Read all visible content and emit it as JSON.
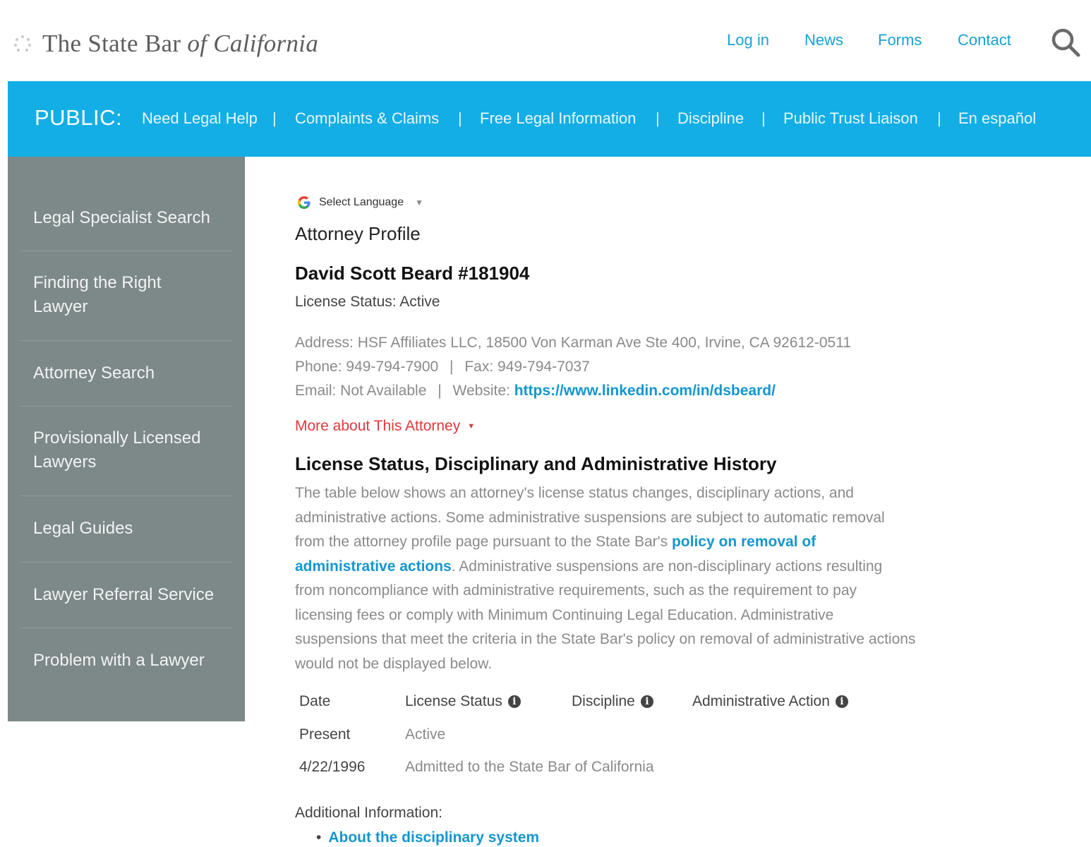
{
  "header": {
    "logo": {
      "text_main": "The State Bar ",
      "text_italic": "of California"
    },
    "nav": [
      "Log in",
      "News",
      "Forms",
      "Contact"
    ]
  },
  "public_nav": {
    "label": "PUBLIC:",
    "items": [
      "Need Legal Help",
      "Complaints & Claims",
      "Free Legal Information",
      "Discipline",
      "Public Trust Liaison",
      "En español"
    ],
    "separator": "|"
  },
  "sidebar": {
    "items": [
      {
        "label_lines": [
          "Legal Specialist Search"
        ]
      },
      {
        "label_lines": [
          "Finding the Right",
          "Lawyer"
        ]
      },
      {
        "label_lines": [
          "Attorney Search"
        ]
      },
      {
        "label_lines": [
          "Provisionally Licensed",
          "Lawyers"
        ]
      },
      {
        "label_lines": [
          "Legal Guides"
        ]
      },
      {
        "label_lines": [
          "Lawyer Referral Service"
        ]
      },
      {
        "label_lines": [
          "Problem with a Lawyer"
        ]
      }
    ]
  },
  "translate": {
    "label": "Select Language"
  },
  "profile": {
    "heading": "Attorney Profile",
    "name": "David Scott Beard #181904",
    "license_status": "License Status: Active",
    "address": "Address: HSF Affiliates LLC, 18500 Von Karman Ave Ste 400, Irvine, CA 92612-0511",
    "phone": "Phone: 949-794-7900",
    "fax": "Fax: 949-794-7037",
    "email": "Email: Not Available",
    "website_label": "Website: ",
    "website_url": "https://www.linkedin.com/in/dsbeard/",
    "pipe": "|",
    "more_link": "More about This Attorney"
  },
  "history": {
    "heading": "License Status, Disciplinary and Administrative History",
    "para_part1": "The table below shows an attorney's license status changes, disciplinary actions, and administrative actions. Some administrative suspensions are subject to automatic removal from the attorney profile page pursuant to the State Bar's ",
    "para_link": "policy on removal of administrative actions",
    "para_part2": ". Administrative suspensions are non-disciplinary actions resulting from noncompliance with administrative requirements, such as the requirement to pay licensing fees or comply with Minimum Continuing Legal Education. Administrative suspensions that meet the criteria in the State Bar's policy on removal of administrative actions would not be displayed below.",
    "table": {
      "headers": [
        "Date",
        "License Status",
        "Discipline",
        "Administrative Action"
      ],
      "rows": [
        {
          "date": "Present",
          "value": "Active"
        },
        {
          "date": "4/22/1996",
          "value": "Admitted to the State Bar of California"
        }
      ]
    }
  },
  "additional": {
    "label": "Additional Information:",
    "links": [
      "About the disciplinary system"
    ]
  }
}
